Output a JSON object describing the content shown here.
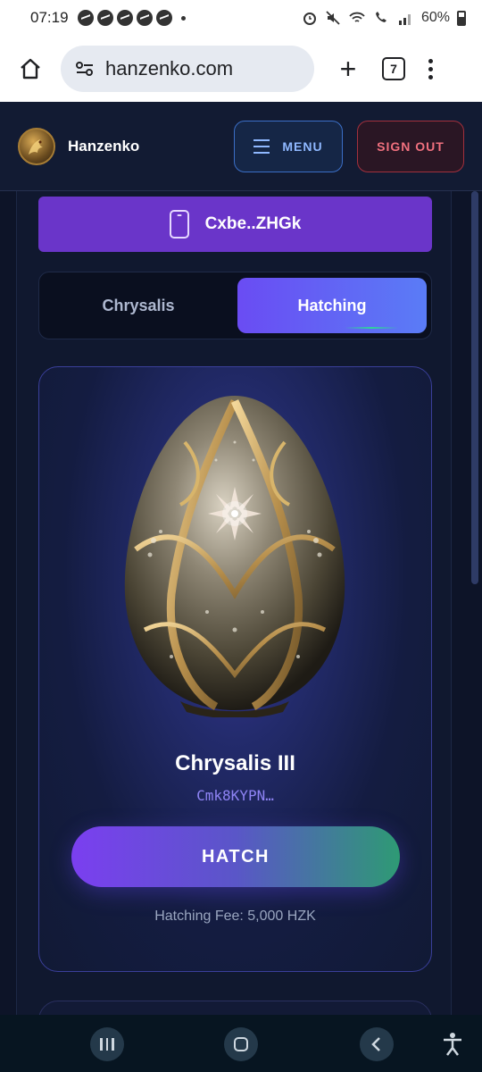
{
  "status_bar": {
    "time": "07:19",
    "battery": "60%"
  },
  "browser": {
    "url": "hanzenko.com",
    "tab_count": "7"
  },
  "header": {
    "brand": "Hanzenko",
    "logo_text": "HANZENKO HZK",
    "menu_label": "MENU",
    "signout_label": "SIGN OUT"
  },
  "wallet": {
    "address": "Cxbe..ZHGk"
  },
  "toggle": {
    "options": [
      "Chrysalis",
      "Hatching"
    ],
    "selected": "Hatching"
  },
  "card": {
    "title": "Chrysalis III",
    "address": "Cmk8KYPN…",
    "hatch_label": "HATCH",
    "fee_text": "Hatching Fee: 5,000 HZK"
  },
  "colors": {
    "accent_purple": "#6a35c9",
    "header_bg": "#121b33",
    "signout_red": "#f0707e",
    "menu_blue": "#8fb8ff",
    "page_bg": "#0d1428"
  },
  "icons": [
    "messenger-icon",
    "alarm-icon",
    "mute-icon",
    "wifi-icon",
    "signal-icon",
    "battery-icon",
    "home-icon",
    "site-settings-icon",
    "new-tab-icon",
    "tab-switcher-icon",
    "overflow-menu-icon",
    "hamburger-icon",
    "phone-icon",
    "egg-image",
    "recent-apps-icon",
    "home-nav-icon",
    "back-icon",
    "accessibility-icon"
  ]
}
